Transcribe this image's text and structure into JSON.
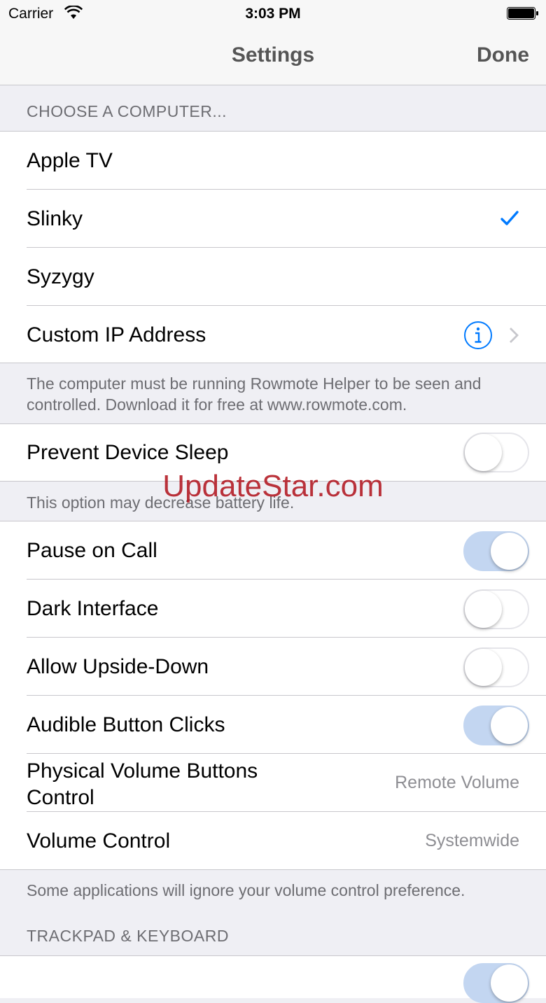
{
  "status_bar": {
    "carrier": "Carrier",
    "time": "3:03 PM"
  },
  "nav": {
    "title": "Settings",
    "done_label": "Done"
  },
  "computers": {
    "header": "CHOOSE A COMPUTER...",
    "items": [
      {
        "label": "Apple TV",
        "selected": false
      },
      {
        "label": "Slinky",
        "selected": true
      },
      {
        "label": "Syzygy",
        "selected": false
      },
      {
        "label": "Custom IP Address",
        "selected": false
      }
    ],
    "footer": "The computer must be running Rowmote Helper to be seen and controlled. Download it for free at www.rowmote.com."
  },
  "sleep": {
    "label": "Prevent Device Sleep",
    "on": false,
    "footer": "This option may decrease battery life."
  },
  "options": {
    "items": [
      {
        "label": "Pause on Call",
        "on": true
      },
      {
        "label": "Dark Interface",
        "on": false
      },
      {
        "label": "Allow Upside-Down",
        "on": false
      },
      {
        "label": "Audible Button Clicks",
        "on": true
      }
    ],
    "physical_volume": {
      "label": "Physical Volume Buttons Control",
      "value": "Remote Volume"
    },
    "volume_control": {
      "label": "Volume Control",
      "value": "Systemwide"
    },
    "footer": "Some applications will ignore your volume control preference."
  },
  "trackpad": {
    "header": "TRACKPAD & KEYBOARD"
  },
  "watermark": "UpdateStar.com",
  "colors": {
    "accent": "#007aff",
    "switch_on": "#c3d6f1",
    "background": "#efeff4"
  }
}
